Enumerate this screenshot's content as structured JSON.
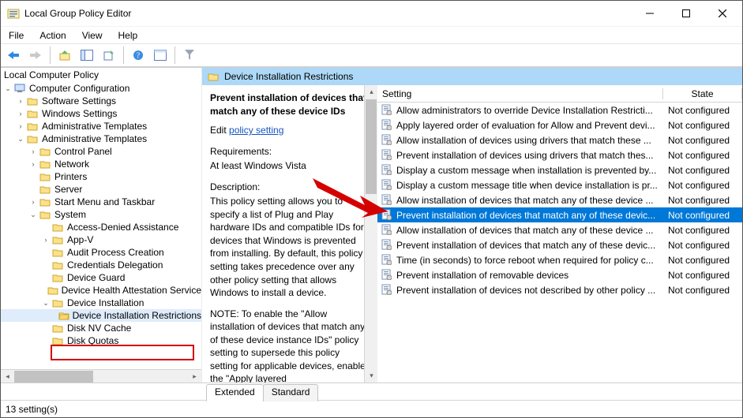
{
  "window": {
    "title": "Local Group Policy Editor",
    "min_label": "Minimize",
    "max_label": "Maximize",
    "close_label": "Close"
  },
  "menu": {
    "file": "File",
    "action": "Action",
    "view": "View",
    "help": "Help"
  },
  "tree_root": "Local Computer Policy",
  "tree": {
    "cc": "Computer Configuration",
    "ss": "Software Settings",
    "ws": "Windows Settings",
    "at": "Administrative Templates",
    "at2": "Administrative Templates",
    "cp": "Control Panel",
    "net": "Network",
    "pr": "Printers",
    "srv": "Server",
    "smt": "Start Menu and Taskbar",
    "sys": "System",
    "ada": "Access-Denied Assistance",
    "appv": "App-V",
    "apc": "Audit Process Creation",
    "cd": "Credentials Delegation",
    "dg": "Device Guard",
    "dhas": "Device Health Attestation Service",
    "di": "Device Installation",
    "dir": "Device Installation Restrictions",
    "dnv": "Disk NV Cache",
    "dq": "Disk Quotas"
  },
  "header_breadcrumb": "Device Installation Restrictions",
  "help": {
    "policy_title": "Prevent installation of devices that match any of these device IDs",
    "edit_prefix": "Edit ",
    "edit_link": "policy setting",
    "req_label": "Requirements:",
    "req_value": "At least Windows Vista",
    "desc_label": "Description:",
    "desc_p1": "This policy setting allows you to specify a list of Plug and Play hardware IDs and compatible IDs for devices that Windows is prevented from installing. By default, this policy setting takes precedence over any other policy setting that allows Windows to install a device.",
    "desc_p2": "NOTE: To enable the \"Allow installation of devices that match any of these device instance IDs\" policy setting to supersede this policy setting for applicable devices, enable the \"Apply layered"
  },
  "list": {
    "col_setting": "Setting",
    "col_state": "State",
    "rows": [
      {
        "name": "Allow administrators to override Device Installation Restricti...",
        "state": "Not configured"
      },
      {
        "name": "Apply layered order of evaluation for Allow and Prevent devi...",
        "state": "Not configured"
      },
      {
        "name": "Allow installation of devices using drivers that match these ...",
        "state": "Not configured"
      },
      {
        "name": "Prevent installation of devices using drivers that match thes...",
        "state": "Not configured"
      },
      {
        "name": "Display a custom message when installation is prevented by...",
        "state": "Not configured"
      },
      {
        "name": "Display a custom message title when device installation is pr...",
        "state": "Not configured"
      },
      {
        "name": "Allow installation of devices that match any of these device ...",
        "state": "Not configured"
      },
      {
        "name": "Prevent installation of devices that match any of these devic...",
        "state": "Not configured"
      },
      {
        "name": "Allow installation of devices that match any of these device ...",
        "state": "Not configured"
      },
      {
        "name": "Prevent installation of devices that match any of these devic...",
        "state": "Not configured"
      },
      {
        "name": "Time (in seconds) to force reboot when required for policy c...",
        "state": "Not configured"
      },
      {
        "name": "Prevent installation of removable devices",
        "state": "Not configured"
      },
      {
        "name": "Prevent installation of devices not described by other policy ...",
        "state": "Not configured"
      }
    ],
    "selected_index": 7
  },
  "tabs": {
    "extended": "Extended",
    "standard": "Standard"
  },
  "status": "13 setting(s)"
}
